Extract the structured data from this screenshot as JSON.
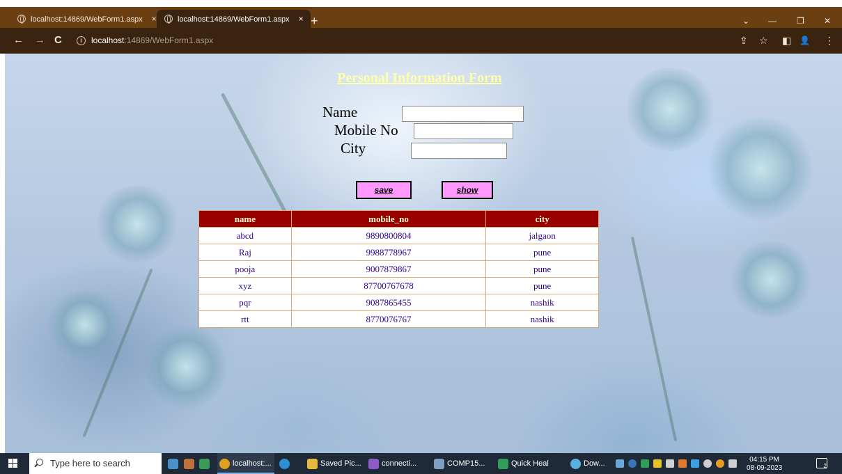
{
  "browser": {
    "tabs": [
      {
        "title": "localhost:14869/WebForm1.aspx",
        "close": "×"
      },
      {
        "title": "localhost:14869/WebForm1.aspx",
        "close": "×"
      }
    ],
    "new_tab": "+",
    "window_controls": {
      "dropdown": "⌄",
      "minimize": "—",
      "restore": "❐",
      "close": "✕"
    },
    "nav": {
      "back": "←",
      "forward": "→",
      "reload": "C"
    },
    "url_host": "localhost",
    "url_rest": ":14869/WebForm1.aspx",
    "info_glyph": "i",
    "toolbar_icons": {
      "share": "⇪",
      "bookmark": "☆",
      "sidepanel": "◧",
      "profile": "👤",
      "menu": "⋮"
    }
  },
  "page": {
    "title": "Personal Information Form",
    "form": {
      "name_label": "Name",
      "name_value": "",
      "mobile_label": "Mobile No",
      "mobile_value": "",
      "city_label": "City",
      "city_value": ""
    },
    "buttons": {
      "save": "save",
      "show": "show"
    },
    "grid": {
      "headers": [
        "name",
        "mobile_no",
        "city"
      ],
      "rows": [
        [
          "abcd",
          "9890800804",
          "jalgaon"
        ],
        [
          "Raj",
          "9988778967",
          "pune"
        ],
        [
          "pooja",
          "9007879867",
          "pune"
        ],
        [
          "xyz",
          "87700767678",
          "pune"
        ],
        [
          "pqr",
          "9087865455",
          "nashik"
        ],
        [
          "rtt",
          "8770076767",
          "nashik"
        ]
      ]
    }
  },
  "taskbar": {
    "search_placeholder": "Type here to search",
    "items": [
      {
        "label": "localhost:...",
        "icon": "chrome-icon"
      },
      {
        "label": "",
        "icon": "edge-icon"
      },
      {
        "label": "Saved Pic...",
        "icon": "folder-icon"
      },
      {
        "label": "connecti...",
        "icon": "network-icon"
      },
      {
        "label": "COMP15...",
        "icon": "image-icon"
      },
      {
        "label": "Quick Heal",
        "icon": "quickheal-icon"
      },
      {
        "label": "Dow...",
        "icon": "weather-icon"
      }
    ],
    "time": "04:15 PM",
    "date": "08-09-2023",
    "notification_count": "2",
    "colors": {
      "taskbar_bg": "#1f2a38",
      "chrome_frame": "#6b3f12",
      "grid_header": "#990000",
      "button": "#ff99ff"
    }
  }
}
